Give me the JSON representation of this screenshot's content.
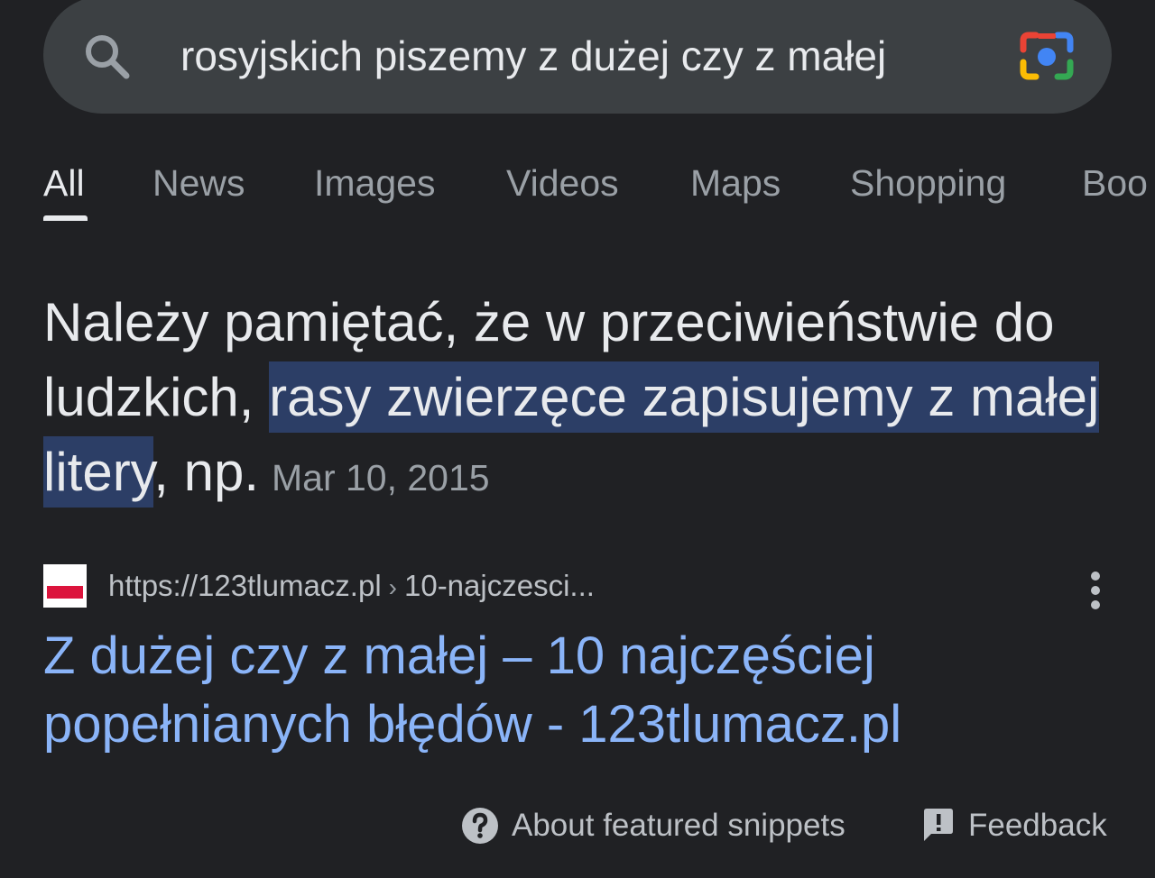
{
  "search": {
    "query": "rosyjskich piszemy z dużej czy z małej"
  },
  "tabs": [
    {
      "label": "All",
      "active": true
    },
    {
      "label": "News",
      "active": false
    },
    {
      "label": "Images",
      "active": false
    },
    {
      "label": "Videos",
      "active": false
    },
    {
      "label": "Maps",
      "active": false
    },
    {
      "label": "Shopping",
      "active": false
    },
    {
      "label": "Boo",
      "active": false
    }
  ],
  "snippet": {
    "text_before": "Należy pamiętać, że w przeciwieństwie do ludzkich, ",
    "text_highlighted": "rasy zwierzęce zapisujemy z małej litery",
    "text_after": ", np.",
    "date": "Mar 10, 2015"
  },
  "source": {
    "url": "https://123tlumacz.pl",
    "separator": "›",
    "path": "10-najczesci..."
  },
  "result": {
    "title": "Z dużej czy z małej – 10 najczęściej popełnianych błędów - 123tlumacz.pl"
  },
  "footer": {
    "about_label": "About featured snippets",
    "feedback_label": "Feedback"
  },
  "icons": {
    "search": "search-icon",
    "lens": "google-lens-icon",
    "more": "more-vert-icon",
    "help": "help-circle-icon",
    "feedback": "feedback-icon"
  },
  "colors": {
    "background": "#202124",
    "search_bar": "#3c4043",
    "link": "#8ab4f8",
    "highlight": "#2c3e66",
    "text_primary": "#e8eaed",
    "text_secondary": "#9aa0a6"
  }
}
